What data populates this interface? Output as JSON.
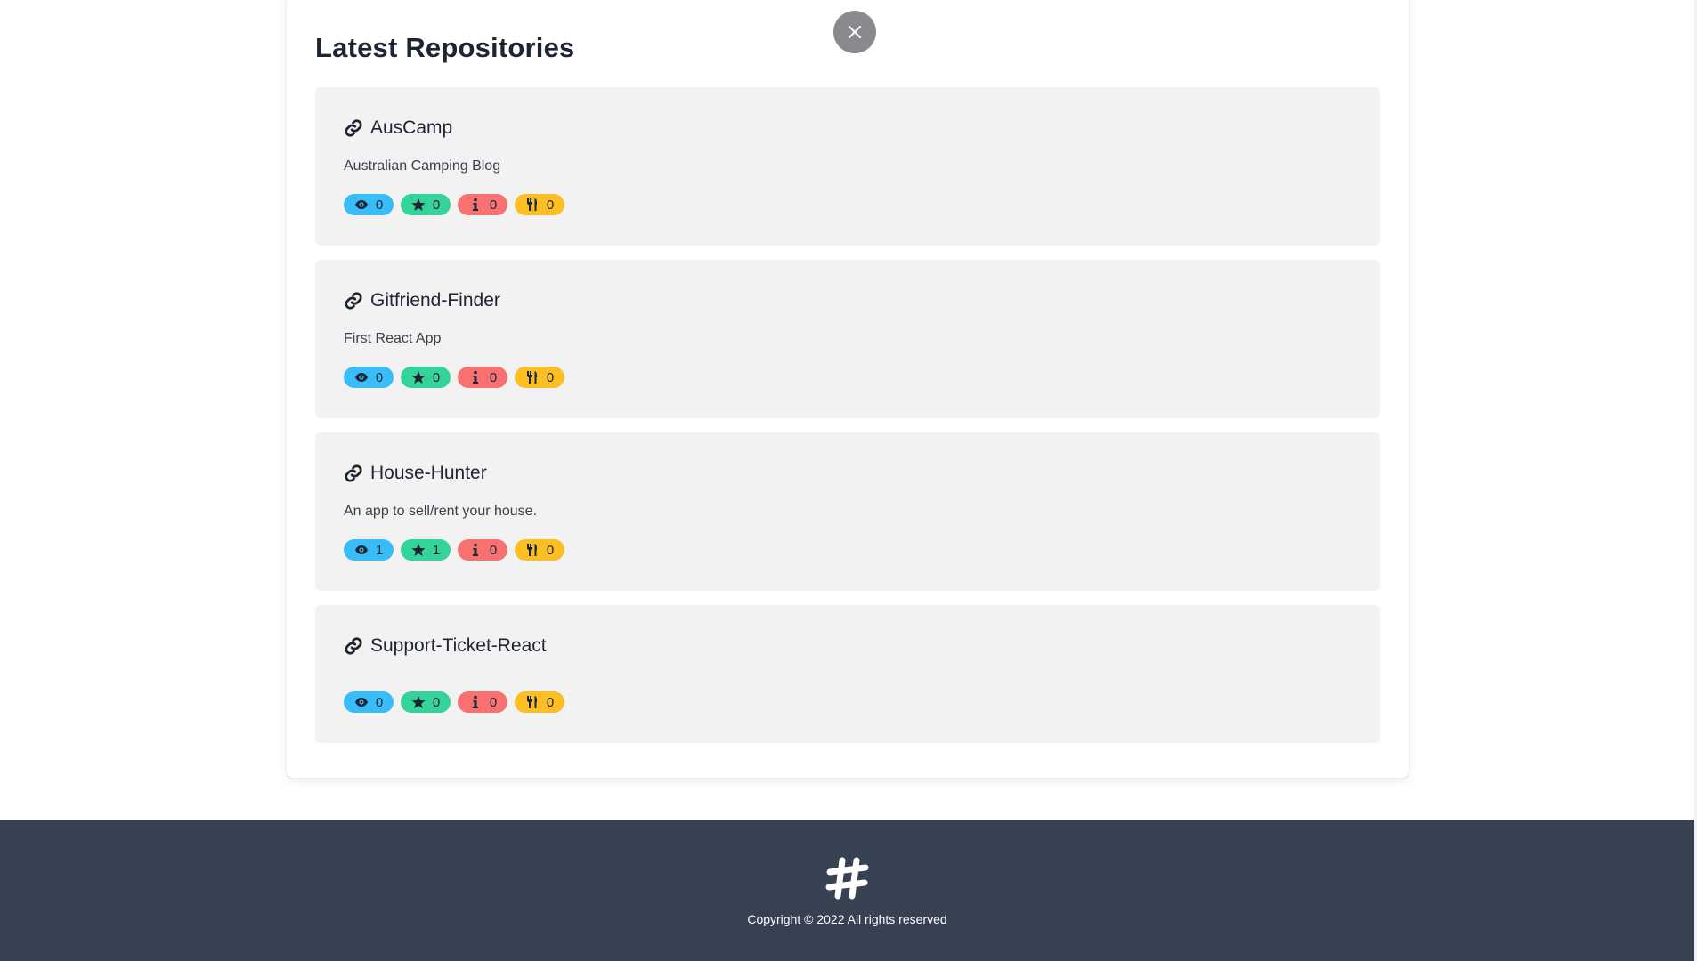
{
  "header": {
    "title": "Latest Repositories"
  },
  "close_button": {
    "icon": "close-icon"
  },
  "repositories": [
    {
      "name": "AusCamp",
      "description": "Australian Camping Blog",
      "watchers": "0",
      "stars": "0",
      "issues": "0",
      "forks": "0"
    },
    {
      "name": "Gitfriend-Finder",
      "description": "First React App",
      "watchers": "0",
      "stars": "0",
      "issues": "0",
      "forks": "0"
    },
    {
      "name": "House-Hunter",
      "description": "An app to sell/rent your house.",
      "watchers": "1",
      "stars": "1",
      "issues": "0",
      "forks": "0"
    },
    {
      "name": "Support-Ticket-React",
      "description": "",
      "watchers": "0",
      "stars": "0",
      "issues": "0",
      "forks": "0"
    }
  ],
  "badge_colors": {
    "watchers": "#38bdf8",
    "stars": "#34d399",
    "issues": "#f87171",
    "forks": "#fbbf24"
  },
  "footer": {
    "logo_icon": "hashtag-icon",
    "copyright": "Copyright © 2022 All rights reserved"
  }
}
